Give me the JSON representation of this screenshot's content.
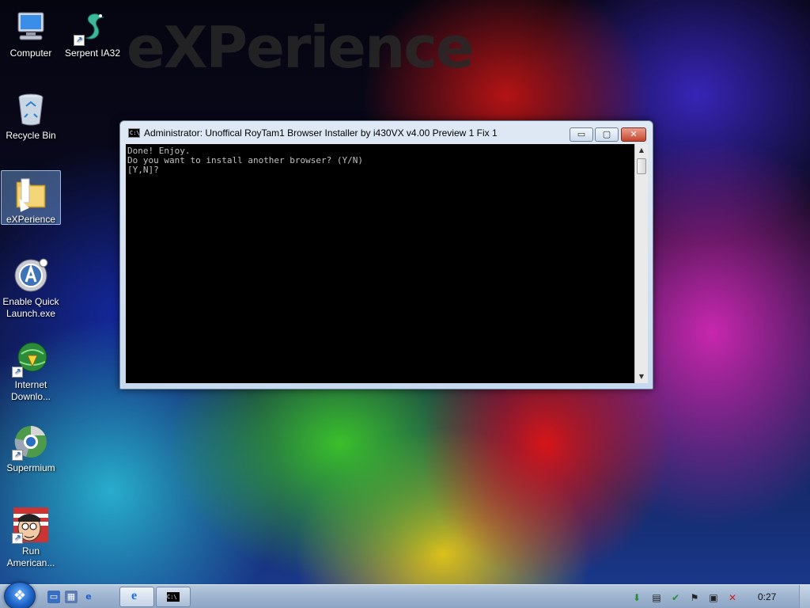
{
  "desktop": {
    "watermark": "eXPerience",
    "icons": [
      {
        "label": "Computer",
        "icon": "computer-icon"
      },
      {
        "label": "Serpent IA32",
        "icon": "serpent-icon"
      },
      {
        "label": "Recycle Bin",
        "icon": "recycle-bin-icon"
      },
      {
        "label": "eXPerience",
        "icon": "folder-icon"
      },
      {
        "label": "Enable Quick Launch.exe",
        "icon": "quick-launch-icon"
      },
      {
        "label": "Internet Downlo...",
        "icon": "idm-icon"
      },
      {
        "label": "Supermium",
        "icon": "supermium-icon"
      },
      {
        "label": "Run American...",
        "icon": "american-dad-icon"
      }
    ]
  },
  "window": {
    "title": "Administrator:  Unoffical RoyTam1 Browser Installer by i430VX v4.00 Preview 1 Fix 1",
    "minimize_glyph": "▭",
    "maximize_glyph": "▢",
    "close_glyph": "✕",
    "console_lines": [
      "Done! Enjoy.",
      "Do you want to install another browser? (Y/N)",
      "[Y,N]?"
    ]
  },
  "taskbar": {
    "clock": "0:27",
    "buttons": [
      {
        "name": "ie-task",
        "glyph": "e"
      },
      {
        "name": "cmd-task",
        "glyph": "C:\\"
      }
    ]
  },
  "colors": {
    "console_bg": "#000000",
    "console_fg": "#c0c0c0",
    "taskbar": "#9db3cf"
  }
}
